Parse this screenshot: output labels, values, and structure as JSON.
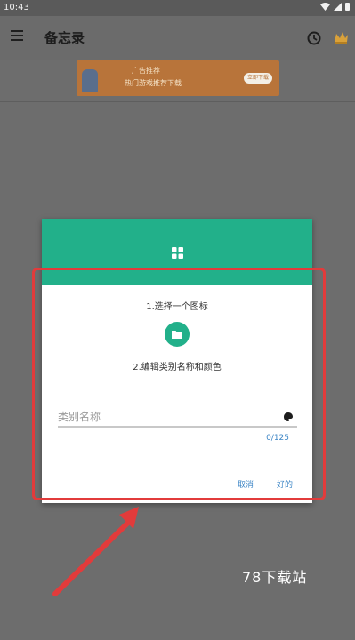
{
  "status_bar": {
    "time": "10:43"
  },
  "app_bar": {
    "title": "备忘录"
  },
  "ad": {
    "line1": "广告推荐",
    "line2": "热门游戏推荐下载",
    "button": "立即下载"
  },
  "dialog": {
    "step1": "1.选择一个图标",
    "step2": "2.编辑类别名称和颜色",
    "input_placeholder": "类别名称",
    "input_value": "",
    "counter": "0/125",
    "cancel_label": "取消",
    "ok_label": "好的"
  },
  "watermark": "78下载站",
  "colors": {
    "accent": "#22b08a",
    "link": "#3d86c6",
    "annotation": "#e23b3b",
    "scrim": "#6d6d6d"
  },
  "icons": [
    "menu-icon",
    "history-icon",
    "crown-icon",
    "grid-icon",
    "folder-icon",
    "palette-icon",
    "wifi-icon",
    "signal-icon",
    "battery-icon"
  ]
}
